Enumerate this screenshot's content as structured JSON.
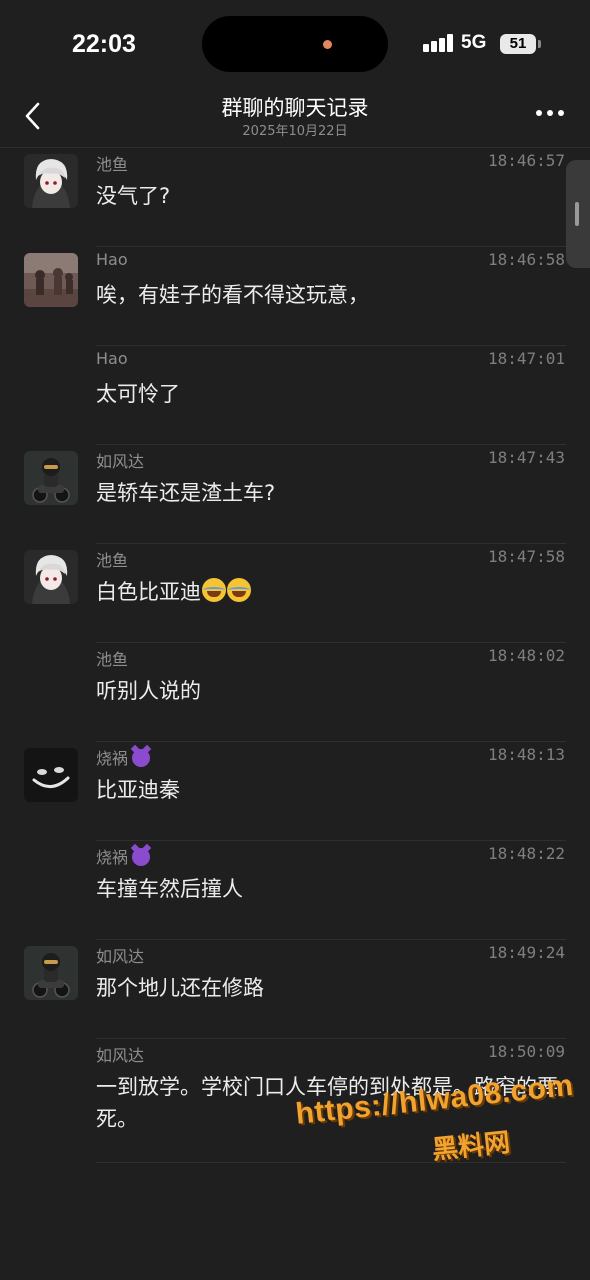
{
  "status_bar": {
    "time": "22:03",
    "network": "5G",
    "battery": "51"
  },
  "nav": {
    "title": "群聊的聊天记录",
    "subtitle": "2025年10月22日"
  },
  "messages": [
    {
      "sender": "池鱼",
      "time": "18:46:57",
      "text": "没气了?",
      "avatar": "avatar-chiyu"
    },
    {
      "sender": "Hao",
      "time": "18:46:58",
      "text": "唉，有娃子的看不得这玩意，",
      "avatar": "avatar-hao"
    },
    {
      "sender": "Hao",
      "time": "18:47:01",
      "text": "太可怜了",
      "avatar": ""
    },
    {
      "sender": "如风达",
      "time": "18:47:43",
      "text": "是轿车还是渣土车?",
      "avatar": "avatar-rufengda"
    },
    {
      "sender": "池鱼",
      "time": "18:47:58",
      "text": "白色比亚迪",
      "avatar": "avatar-chiyu",
      "emoji": "joy-emoji"
    },
    {
      "sender": "池鱼",
      "time": "18:48:02",
      "text": "听别人说的",
      "avatar": ""
    },
    {
      "sender": "烧祸",
      "time": "18:48:13",
      "text": "比亚迪秦",
      "avatar": "avatar-shaohuo",
      "sender_emoji": "devil-emoji"
    },
    {
      "sender": "烧祸",
      "time": "18:48:22",
      "text": "车撞车然后撞人",
      "avatar": "",
      "sender_emoji": "devil-emoji"
    },
    {
      "sender": "如风达",
      "time": "18:49:24",
      "text": "那个地儿还在修路",
      "avatar": "avatar-rufengda"
    },
    {
      "sender": "如风达",
      "time": "18:50:09",
      "text": "一到放学。学校门口人车停的到处都是。路窄的要死。",
      "avatar": ""
    }
  ],
  "watermark": {
    "url": "https://hlwa08.com",
    "label": "黑料网"
  },
  "colors": {
    "background": "#1f1f1f",
    "watermark": "#f2a22f"
  }
}
